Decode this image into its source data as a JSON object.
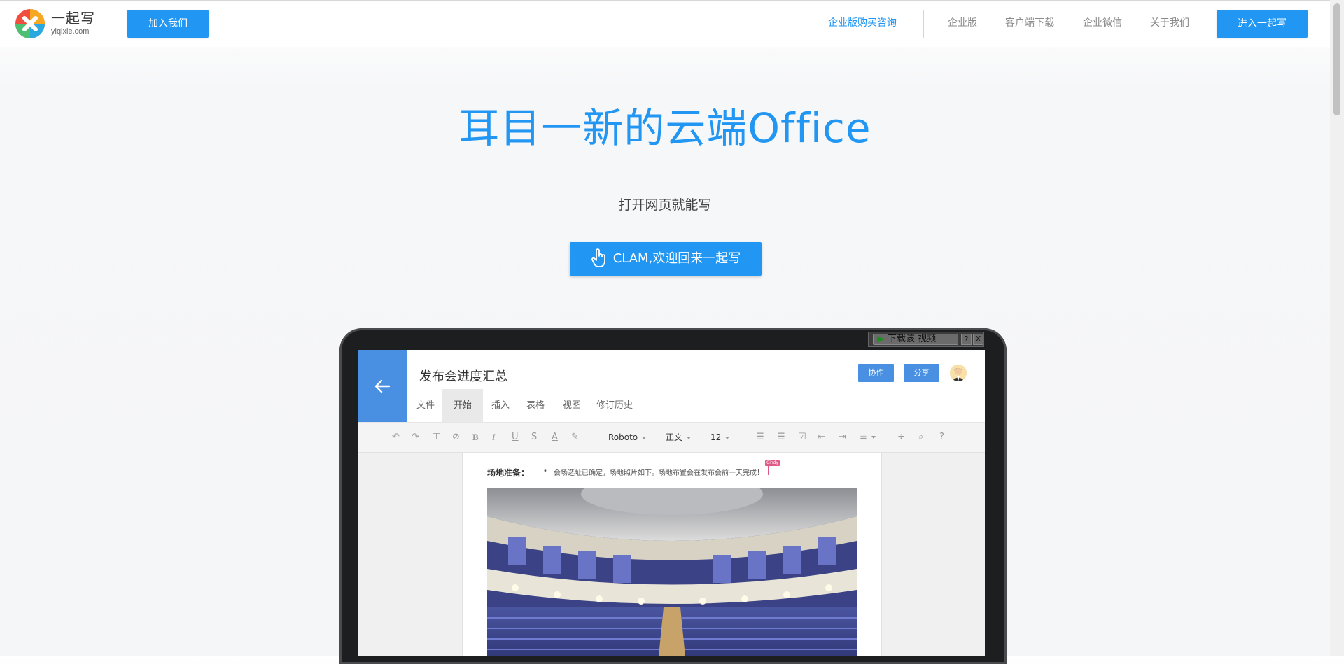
{
  "header": {
    "logo_cn": "一起写",
    "logo_en": "yiqixie.com",
    "join_button": "加入我们",
    "nav": [
      {
        "label": "企业版购买咨询",
        "primary": true
      },
      {
        "label": "企业版"
      },
      {
        "label": "客户端下载"
      },
      {
        "label": "企业微信"
      },
      {
        "label": "关于我们"
      }
    ],
    "enter_button": "进入一起写"
  },
  "hero": {
    "title": "耳目一新的云端Office",
    "subtitle": "打开网页就能写",
    "welcome_button": "CLAM,欢迎回来一起写"
  },
  "video_overlay": {
    "download_label": "下载该 视频",
    "help": "?",
    "close": "X"
  },
  "doc": {
    "title": "发布会进度汇总",
    "collab_button": "协作",
    "share_button": "分享",
    "tabs": [
      "文件",
      "开始",
      "插入",
      "表格",
      "视图",
      "修订历史"
    ],
    "active_tab": "开始",
    "toolbar": {
      "font": "Roboto",
      "style": "正文",
      "size": "12"
    },
    "content": {
      "label": "场地准备：",
      "bullet": "•",
      "text": "会场选址已确定，场地照片如下。场地布置会在发布会前一天完成！",
      "cursor_user": "Cindy"
    }
  },
  "colors": {
    "brand_blue": "#2196f3",
    "doc_blue": "#4a90e2",
    "cursor_pink": "#e05a87"
  }
}
